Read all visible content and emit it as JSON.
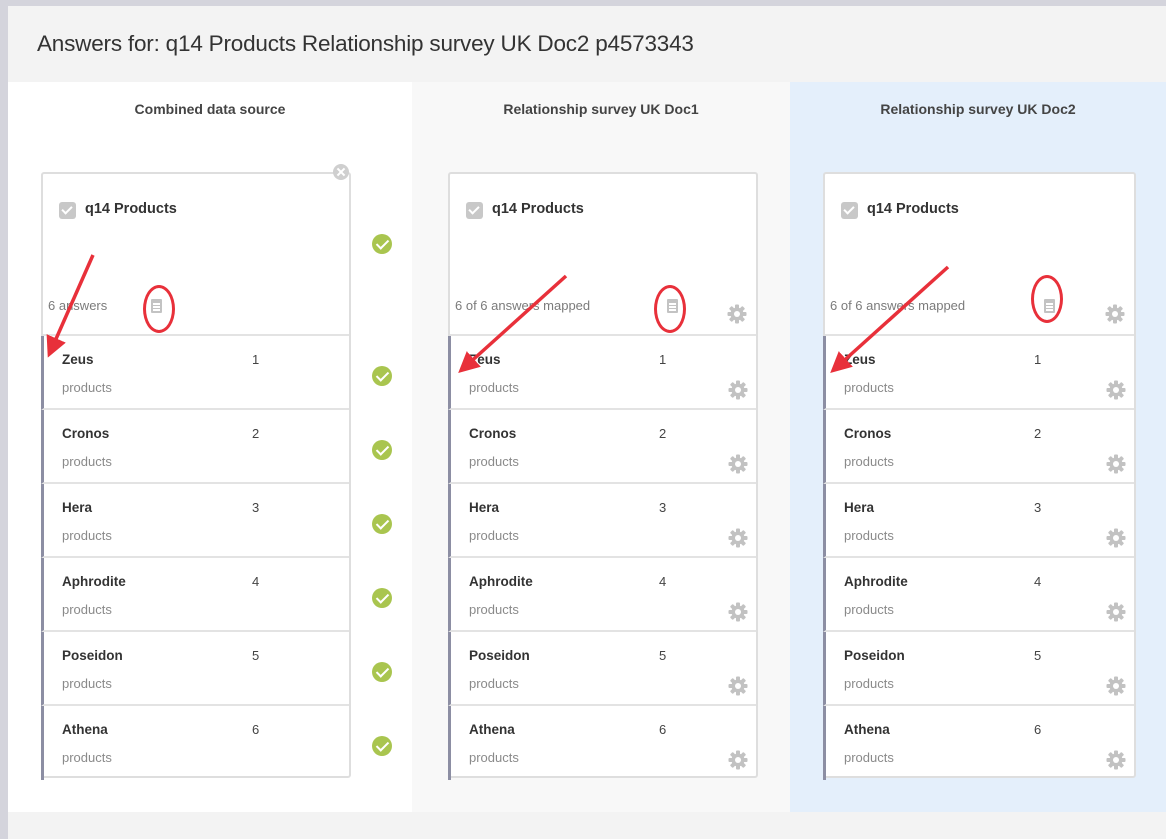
{
  "header": {
    "title": "Answers for: q14 Products Relationship survey UK Doc2 p4573343"
  },
  "columns": [
    {
      "title": "Combined data source",
      "card": {
        "question": "q14 Products",
        "answers_info": "6 answers",
        "rows": [
          {
            "name": "Zeus",
            "code": "1",
            "sub": "products"
          },
          {
            "name": "Cronos",
            "code": "2",
            "sub": "products"
          },
          {
            "name": "Hera",
            "code": "3",
            "sub": "products"
          },
          {
            "name": "Aphrodite",
            "code": "4",
            "sub": "products"
          },
          {
            "name": "Poseidon",
            "code": "5",
            "sub": "products"
          },
          {
            "name": "Athena",
            "code": "6",
            "sub": "products"
          }
        ]
      }
    },
    {
      "title": "Relationship survey UK Doc1",
      "card": {
        "question": "q14 Products",
        "answers_info": "6 of 6 answers mapped",
        "rows": [
          {
            "name": "Zeus",
            "code": "1",
            "sub": "products"
          },
          {
            "name": "Cronos",
            "code": "2",
            "sub": "products"
          },
          {
            "name": "Hera",
            "code": "3",
            "sub": "products"
          },
          {
            "name": "Aphrodite",
            "code": "4",
            "sub": "products"
          },
          {
            "name": "Poseidon",
            "code": "5",
            "sub": "products"
          },
          {
            "name": "Athena",
            "code": "6",
            "sub": "products"
          }
        ]
      }
    },
    {
      "title": "Relationship survey UK Doc2",
      "card": {
        "question": "q14 Products",
        "answers_info": "6 of 6 answers mapped",
        "rows": [
          {
            "name": "Zeus",
            "code": "1",
            "sub": "products"
          },
          {
            "name": "Cronos",
            "code": "2",
            "sub": "products"
          },
          {
            "name": "Hera",
            "code": "3",
            "sub": "products"
          },
          {
            "name": "Aphrodite",
            "code": "4",
            "sub": "products"
          },
          {
            "name": "Poseidon",
            "code": "5",
            "sub": "products"
          },
          {
            "name": "Athena",
            "code": "6",
            "sub": "products"
          }
        ]
      }
    }
  ],
  "icons": {
    "gear": "gear-icon",
    "mapped_check": "check-circle-icon",
    "answers_list": "document-icon",
    "remove": "close-icon",
    "select": "checkbox-icon"
  },
  "colors": {
    "accent_green": "#a9c54f",
    "selected_column": "#e4effb",
    "annotation_red": "#e8303a",
    "row_marker": "#8c8ea3"
  }
}
